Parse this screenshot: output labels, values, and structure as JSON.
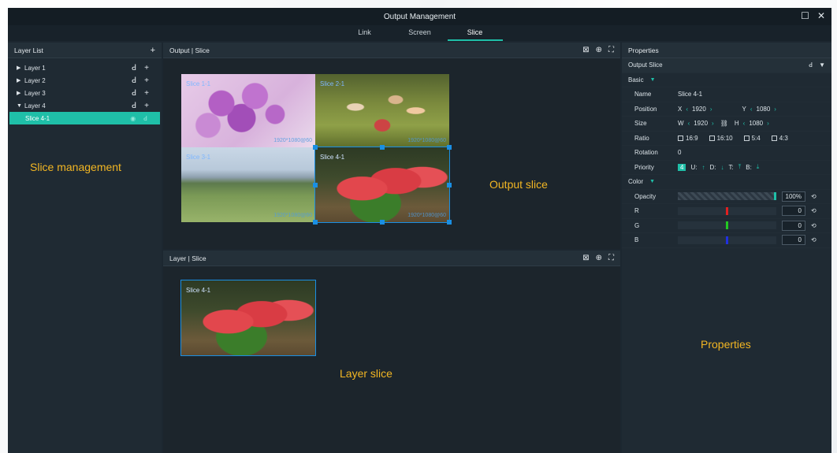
{
  "window": {
    "title": "Output Management",
    "maximize_icon": "☐",
    "close_icon": "✕"
  },
  "tabs": [
    {
      "label": "Link"
    },
    {
      "label": "Screen"
    },
    {
      "label": "Slice",
      "active": true
    }
  ],
  "layer_list": {
    "title": "Layer List",
    "add_icon": "+",
    "items": [
      {
        "label": "Layer 1",
        "expanded": false
      },
      {
        "label": "Layer 2",
        "expanded": false
      },
      {
        "label": "Layer 3",
        "expanded": false
      },
      {
        "label": "Layer 4",
        "expanded": true
      },
      {
        "label": "Slice 4-1",
        "selected": true
      }
    ],
    "annotation": "Slice management"
  },
  "output_panel": {
    "title": "Output | Slice",
    "slices": [
      {
        "label": "Slice 1-1",
        "res": "1920*1080@60",
        "image": "lilac"
      },
      {
        "label": "Slice 2-1",
        "res": "1920*1080@60",
        "image": "family"
      },
      {
        "label": "Slice 3-1",
        "res": "1920*1080@60",
        "image": "landscape"
      },
      {
        "label": "Slice 4-1",
        "res": "1920*1080@60",
        "image": "watermelon"
      }
    ],
    "annotation": "Output slice"
  },
  "layer_panel": {
    "title": "Layer | Slice",
    "slice_label": "Slice 4-1",
    "annotation": "Layer slice"
  },
  "properties": {
    "title": "Properties",
    "section": "Output Slice",
    "basic": {
      "title": "Basic",
      "name_label": "Name",
      "name": "Slice 4-1",
      "position_label": "Position",
      "x_label": "X",
      "x": "1920",
      "y_label": "Y",
      "y": "1080",
      "size_label": "Size",
      "w_label": "W",
      "w": "1920",
      "h_label": "H",
      "h": "1080",
      "ratio_label": "Ratio",
      "ratios": [
        "16:9",
        "16:10",
        "5:4",
        "4:3"
      ],
      "rotation_label": "Rotation",
      "rotation": "0",
      "priority_label": "Priority",
      "priority": "4",
      "u": "U:",
      "d": "D:",
      "t": "T:",
      "b": "B:"
    },
    "color": {
      "title": "Color",
      "opacity_label": "Opacity",
      "opacity": "100%",
      "r_label": "R",
      "r": "0",
      "g_label": "G",
      "g": "0",
      "b_label": "B",
      "b": "0",
      "opacity_level": 1.0
    },
    "annotation": "Properties"
  },
  "colors": {
    "accent": "#1fbfa8",
    "annotation": "#f2b623",
    "handle": "#1a8fe3"
  }
}
